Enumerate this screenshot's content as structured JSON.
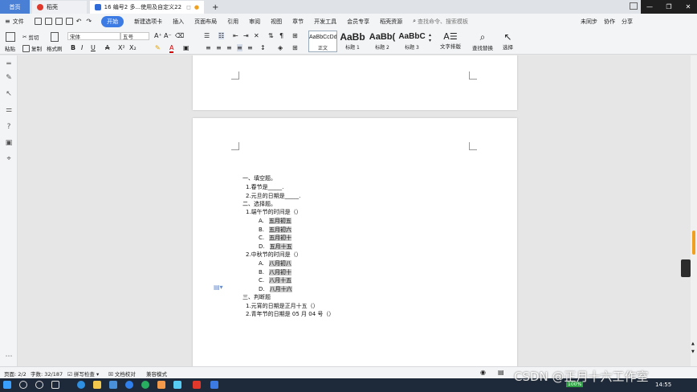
{
  "titlebar": {
    "tabs": [
      {
        "label": "首页"
      },
      {
        "label": "稻壳"
      },
      {
        "label": "16 编号2 多...使用及自定义22"
      }
    ],
    "new_tab": "+"
  },
  "menubar": {
    "file": "文件",
    "items": [
      "开始",
      "新建选项卡",
      "插入",
      "页面布局",
      "引用",
      "审阅",
      "视图",
      "章节",
      "开发工具",
      "会员专享",
      "稻壳资源"
    ],
    "search_placeholder": "查找命令、搜索模板",
    "right": [
      "未同步",
      "协作",
      "分享"
    ]
  },
  "ribbon": {
    "paste": "粘贴",
    "cut": "剪切",
    "copy": "复制",
    "format_painter": "格式刷",
    "font_name": "宋体",
    "font_size": "五号",
    "styles": [
      {
        "sample": "AaBbCcDd",
        "label": "正文"
      },
      {
        "sample": "AaBb",
        "label": "标题 1"
      },
      {
        "sample": "AaBb(",
        "label": "标题 2"
      },
      {
        "sample": "AaBbC",
        "label": "标题 3"
      }
    ],
    "text_layout": "文字排版",
    "find_replace": "查找替换",
    "select": "选择"
  },
  "document": {
    "lines": [
      {
        "text": "一、填空题。",
        "indent": 0
      },
      {
        "text": "1.春节是_____.",
        "indent": 1
      },
      {
        "text": "2.元旦的日期是_____.",
        "indent": 1
      },
      {
        "text": "二、选择题。",
        "indent": 0
      },
      {
        "text": "1.端午节的时间是（）",
        "indent": 1
      },
      {
        "label": "A.",
        "text": "五月初五",
        "indent": 2
      },
      {
        "label": "B.",
        "text": "五月初六",
        "indent": 2
      },
      {
        "label": "C.",
        "text": "五月初十",
        "indent": 2
      },
      {
        "label": "D.",
        "text": "五月十五",
        "indent": 2
      },
      {
        "text": "2.中秋节的时间是（）",
        "indent": 1
      },
      {
        "label": "A.",
        "text": "八月初八",
        "indent": 2
      },
      {
        "label": "B.",
        "text": "八月初十",
        "indent": 2
      },
      {
        "label": "C.",
        "text": "八月十五",
        "indent": 2
      },
      {
        "label": "D.",
        "text": "八月十六",
        "indent": 2
      },
      {
        "text": "三、判断题",
        "indent": 0
      },
      {
        "text": "1.元宵的日期是正月十五（）",
        "indent": 1
      },
      {
        "text": "2.青年节的日期是 05 月 04 号（）",
        "indent": 1
      }
    ]
  },
  "statusbar": {
    "page": "页面: 2/2",
    "wordcount": "字数: 32/187",
    "spellcheck": "拼写检查",
    "proofread": "文档校对",
    "compat": "兼容模式"
  },
  "taskbar": {
    "time": "14:55",
    "watermark": "CSDN @正月十六工作室",
    "battery": "100%"
  }
}
